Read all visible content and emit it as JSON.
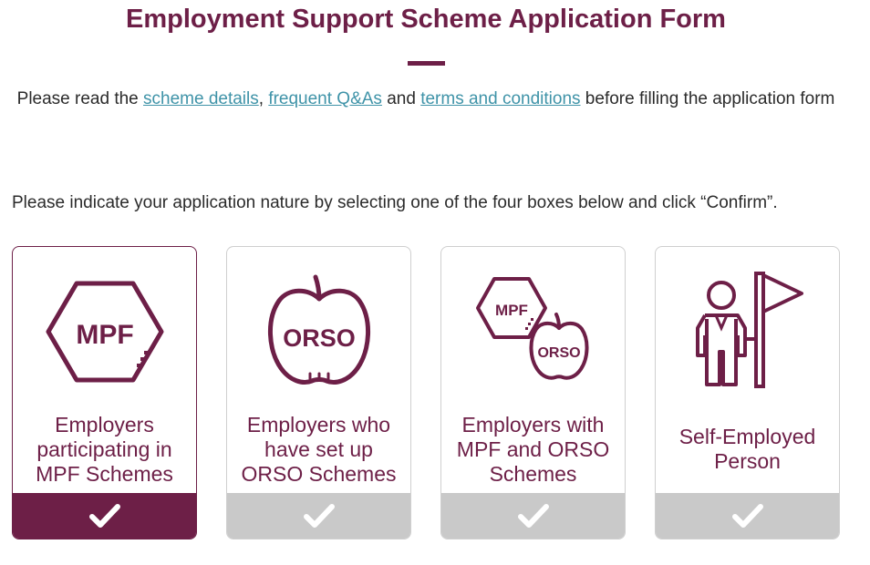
{
  "page": {
    "title": "Employment Support Scheme Application Form",
    "intro_prefix": "Please read the ",
    "link_scheme_details": "scheme details",
    "sep_comma": ", ",
    "link_faq": "frequent Q&As",
    "sep_and": " and ",
    "link_terms": "terms and conditions",
    "intro_suffix": " before filling the application form",
    "instruction": "Please indicate your application nature by selecting one of the four boxes below and click “Confirm”."
  },
  "options": [
    {
      "label": "Employers participating in MPF Schemes",
      "icon": "mpf-hexagon-icon",
      "selected": true
    },
    {
      "label": "Employers who have set up ORSO Schemes",
      "icon": "orso-apple-icon",
      "selected": false
    },
    {
      "label": "Employers with MPF and ORSO Schemes",
      "icon": "mpf-orso-combined-icon",
      "selected": false
    },
    {
      "label": "Self-Employed Person",
      "icon": "person-flag-icon",
      "selected": false
    }
  ],
  "icon_text": {
    "mpf": "MPF",
    "orso": "ORSO"
  },
  "colors": {
    "brand": "#6d1f47",
    "link": "#3f93a8",
    "unselected_bar": "#c9c9c9"
  }
}
